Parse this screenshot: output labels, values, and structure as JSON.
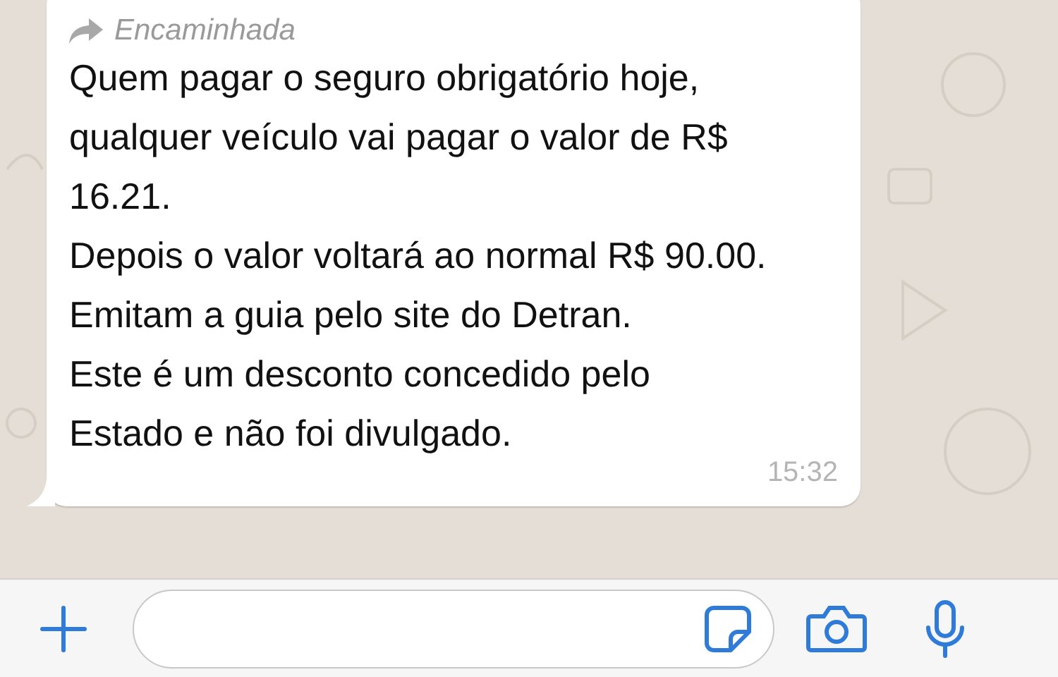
{
  "message": {
    "forwarded": true,
    "forwarded_label": "Encaminhada",
    "paragraphs": [
      "Quem pagar o seguro obrigatório hoje, qualquer veículo vai pagar o valor de R$ 16.21.",
      "Depois o valor voltará ao normal R$ 90.00.",
      "Emitam a guia pelo site do Detran.",
      "Este é um desconto concedido pelo Estado e não foi divulgado."
    ],
    "time": "15:32"
  },
  "composer": {
    "buttons": [
      {
        "kind": "plus"
      },
      {
        "kind": "camera"
      },
      {
        "kind": "mic"
      }
    ]
  }
}
